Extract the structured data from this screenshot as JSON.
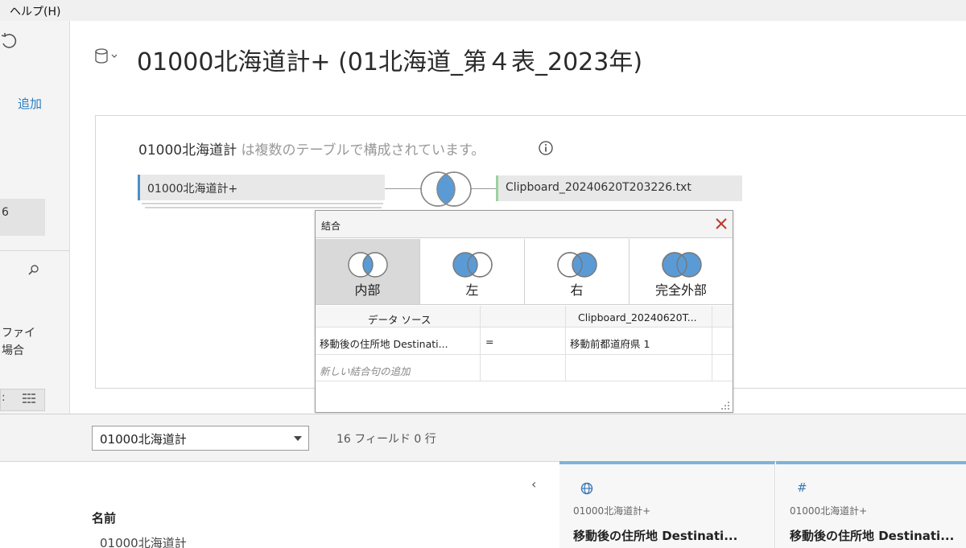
{
  "menu": {
    "help_label": "ヘルプ(H)"
  },
  "left_panel": {
    "add_label": "追加",
    "connection_count": "6",
    "file_label_line1": "ファイ",
    "file_label_line2": "場合",
    "view_colon": ":"
  },
  "title": {
    "text": "01000北海道計+ (01北海道_第４表_2023年)"
  },
  "canvas": {
    "heading_table": "01000北海道計",
    "heading_suffix": " は複数のテーブルで構成されています。",
    "left_table": "01000北海道計+",
    "right_table": "Clipboard_20240620T203226.txt"
  },
  "join_dialog": {
    "title": "結合",
    "join_types": [
      {
        "label": "内部",
        "selected": true
      },
      {
        "label": "左",
        "selected": false
      },
      {
        "label": "右",
        "selected": false
      },
      {
        "label": "完全外部",
        "selected": false
      }
    ],
    "clause_header_left": "データ ソース",
    "clause_header_right": "Clipboard_20240620T...",
    "clause_left_field": "移動後の住所地 Destinati...",
    "clause_operator": "=",
    "clause_right_field": "移動前都道府県  1",
    "add_clause_label": "新しい結合句の追加"
  },
  "bottom": {
    "table_select_value": "01000北海道計",
    "field_count": "16 フィールド 0 行",
    "name_header": "名前",
    "name_rows": [
      "01000北海道計"
    ],
    "columns": [
      {
        "icon": "globe-icon",
        "source": "01000北海道計+",
        "name": "移動後の住所地 Destinati..."
      },
      {
        "icon": "number-icon",
        "source": "01000北海道計+",
        "name": "移動後の住所地 Destinati..."
      }
    ]
  },
  "colors": {
    "accent_blue": "#4a90c8",
    "venn_fill": "#5b9bd5",
    "right_table_accent": "#9bd19f",
    "close_red": "#c0392b"
  }
}
